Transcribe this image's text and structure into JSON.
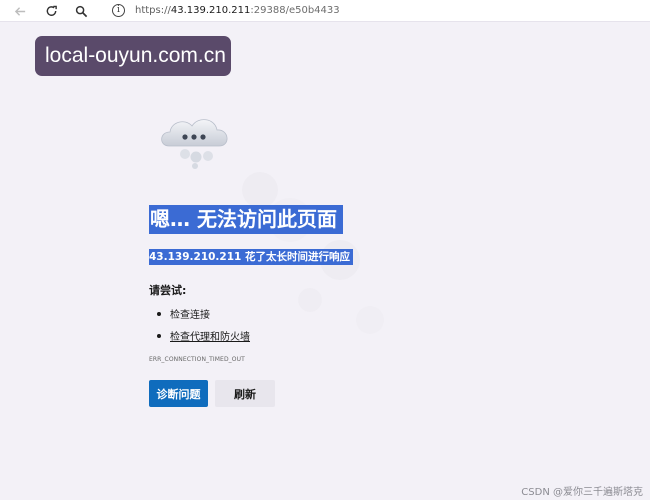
{
  "browser": {
    "url_scheme": "https://",
    "url_host": "43.139.210.211",
    "url_rest": ":29388/e50b4433"
  },
  "watermark": {
    "text": "local-ouyun.com.cn"
  },
  "error": {
    "title": "嗯… 无法访问此页面",
    "subtitle": "43.139.210.211 花了太长时间进行响应",
    "try_label": "请尝试:",
    "suggestions": [
      "检查连接",
      "检查代理和防火墙"
    ],
    "code": "ERR_CONNECTION_TIMED_OUT",
    "diagnose_button": "诊断问题",
    "refresh_button": "刷新"
  },
  "footer": {
    "credit": "CSDN @爱你三千遍斯塔克"
  },
  "colors": {
    "page_bg": "#f3f1f7",
    "highlight": "#3b6bd4",
    "primary_button": "#0f6cbd",
    "watermark_bg": "#5a4a6a"
  }
}
